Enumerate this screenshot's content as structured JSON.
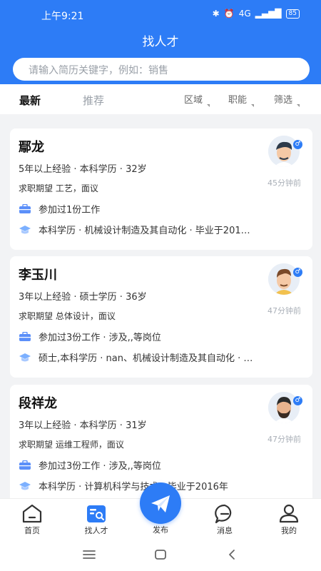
{
  "status": {
    "time": "上午9:21",
    "battery": "85",
    "signal": "4G"
  },
  "header": {
    "title": "找人才"
  },
  "search": {
    "placeholder": "请输入简历关键字，例如：销售"
  },
  "tabs": [
    {
      "label": "最新",
      "active": true
    },
    {
      "label": "推荐",
      "active": false
    }
  ],
  "filters": [
    {
      "label": "区域"
    },
    {
      "label": "职能"
    },
    {
      "label": "筛选"
    }
  ],
  "candidates": [
    {
      "name": "鄢龙",
      "info": "5年以上经验 · 本科学历 · 32岁",
      "desire": "求职期望 工艺，面议",
      "work": "参加过1份工作",
      "education": "本科学历 · 机械设计制造及其自动化 · 毕业于201…",
      "ago": "45分钟前",
      "gender": "♂"
    },
    {
      "name": "李玉川",
      "info": "3年以上经验 · 硕士学历 · 36岁",
      "desire": "求职期望 总体设计，面议",
      "work": "参加过3份工作 · 涉及,,等岗位",
      "education": "硕士,本科学历 · nan、机械设计制造及其自动化 · …",
      "ago": "47分钟前",
      "gender": "♂"
    },
    {
      "name": "段祥龙",
      "info": "3年以上经验 · 本科学历 · 31岁",
      "desire": "求职期望 运维工程师，面议",
      "work": "参加过3份工作 · 涉及,,等岗位",
      "education": "本科学历 · 计算机科学与技术 · 毕业于2016年",
      "ago": "47分钟前",
      "gender": "♂"
    }
  ],
  "nav": {
    "items": [
      {
        "label": "首页"
      },
      {
        "label": "找人才"
      },
      {
        "label": "消息"
      },
      {
        "label": "我的"
      }
    ],
    "fab_label": "发布"
  },
  "colors": {
    "accent": "#2d7cf6"
  }
}
